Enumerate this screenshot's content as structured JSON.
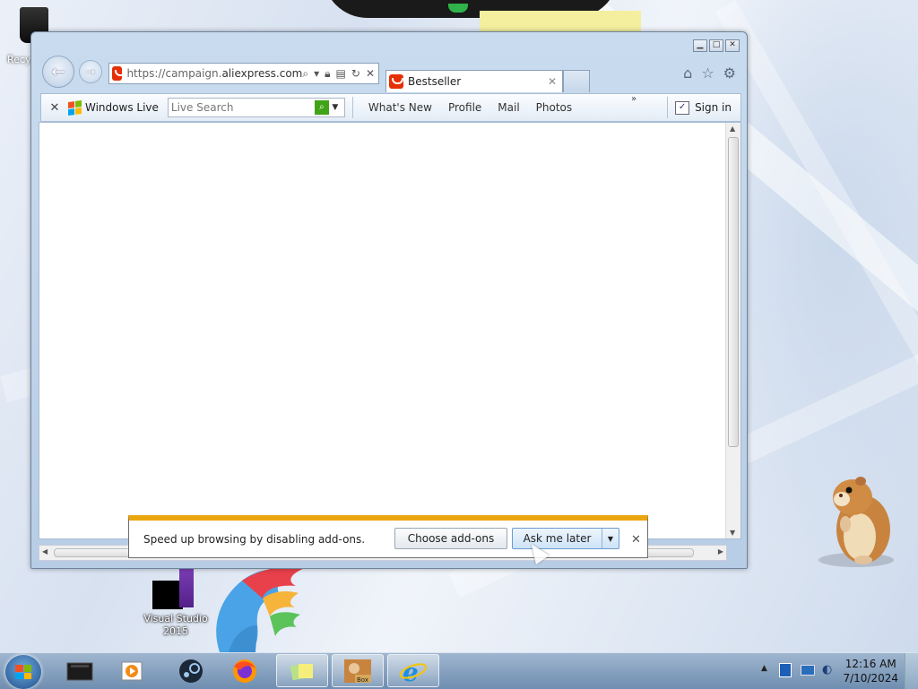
{
  "desktop": {
    "icons": [
      {
        "label": "Recy"
      },
      {
        "label": "Visual Studio 2015"
      }
    ]
  },
  "browser": {
    "window_controls": {
      "minimize": "▁",
      "maximize": "□",
      "close": "✕"
    },
    "address": {
      "scheme": "https://",
      "host_prefix": "campaign.",
      "host": "aliexpress.com"
    },
    "tab": {
      "title": "Bestseller",
      "close": "✕"
    },
    "toolbar": {
      "close": "✕",
      "windows_live": "Windows Live",
      "search_placeholder": "Live Search",
      "links": [
        "What's New",
        "Profile",
        "Mail",
        "Photos"
      ],
      "more": "»",
      "sign_in": "Sign in"
    }
  },
  "notification": {
    "message": "Speed up browsing by disabling add-ons.",
    "choose_addons": "Choose add-ons",
    "ask_later": "Ask me later",
    "close": "✕"
  },
  "taskbar": {
    "time": "12:16 AM",
    "date": "7/10/2024",
    "apps": [
      "terminal",
      "media-player",
      "steam",
      "firefox",
      "sticky-notes",
      "sandbox",
      "internet-explorer"
    ]
  },
  "colors": {
    "notification_accent": "#eaa60f",
    "favicon": "#e62e04",
    "search_go": "#41a317"
  }
}
